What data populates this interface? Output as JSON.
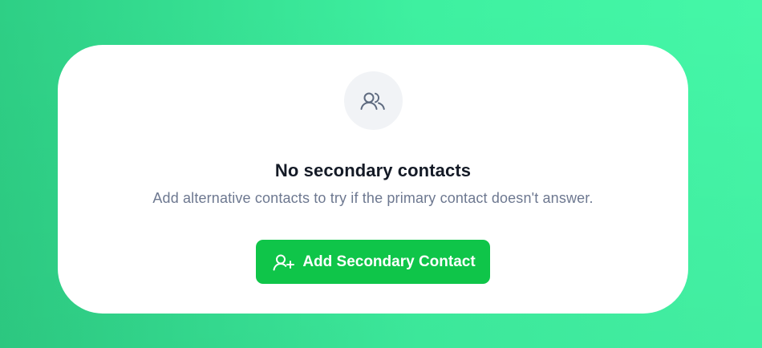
{
  "empty_state": {
    "icon": "users-icon",
    "title": "No secondary contacts",
    "description": "Add alternative contacts to try if the primary contact doesn't answer.",
    "button": {
      "label": "Add Secondary Contact",
      "icon": "user-plus-icon"
    }
  },
  "colors": {
    "background_start": "#2ecf85",
    "background_end": "#45f7a8",
    "card": "#ffffff",
    "icon_circle": "#f1f3f6",
    "title": "#141a26",
    "description": "#6d7890",
    "button": "#0fc549",
    "button_text": "#ffffff"
  }
}
